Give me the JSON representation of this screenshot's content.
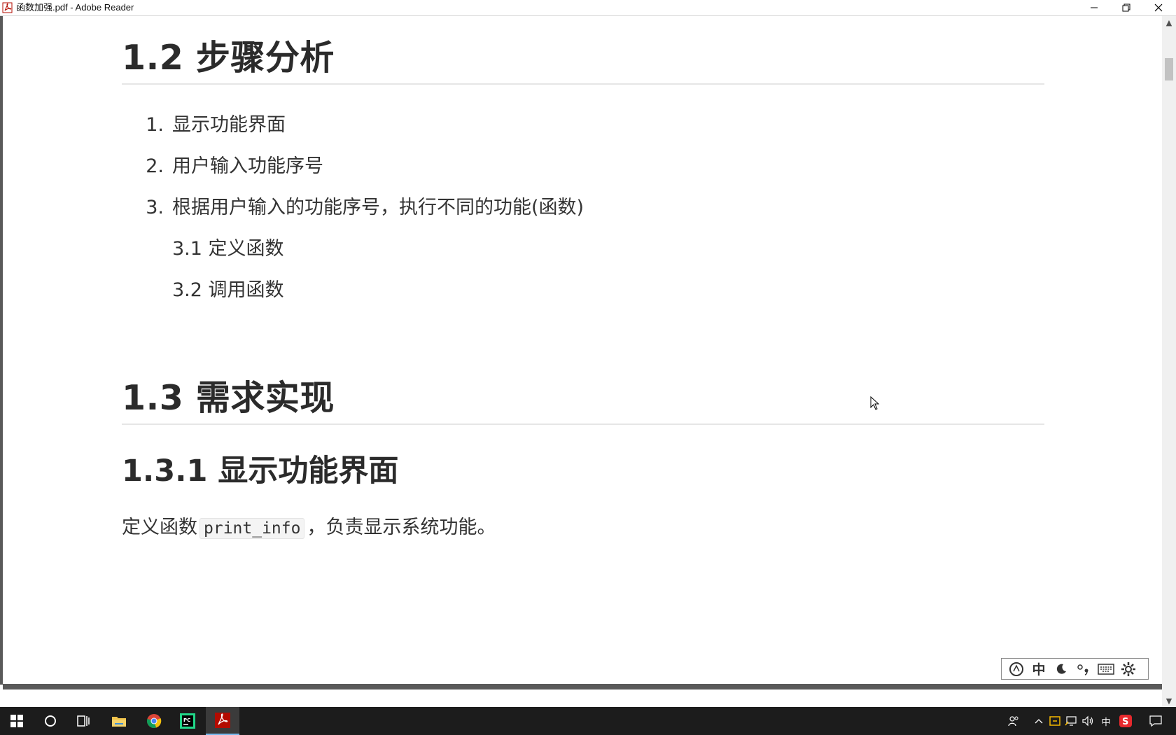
{
  "window": {
    "title": "函数加强.pdf - Adobe Reader"
  },
  "document": {
    "section_1_2": {
      "heading": "1.2 步骤分析",
      "steps": [
        {
          "num": "1.",
          "text": "显示功能界面"
        },
        {
          "num": "2.",
          "text": "用户输入功能序号"
        },
        {
          "num": "3.",
          "text": "根据用户输入的功能序号，执行不同的功能(函数)"
        }
      ],
      "substeps": [
        "3.1 定义函数",
        "3.2 调用函数"
      ]
    },
    "section_1_3": {
      "heading": "1.3 需求实现"
    },
    "section_1_3_1": {
      "heading": "1.3.1 显示功能界面",
      "para_before": "定义函数",
      "code": "print_info",
      "para_after": "，负责显示系统功能。"
    }
  },
  "ime_toolbar": {
    "items": [
      "logo-icon",
      "中",
      "moon-icon",
      "punctuation-icon",
      "keyboard-icon",
      "gear-icon"
    ],
    "mode_label": "中"
  },
  "taskbar": {
    "apps": [
      "start-icon",
      "cortana-icon",
      "task-view-icon",
      "file-explorer-icon",
      "chrome-icon",
      "pycharm-icon",
      "acrobat-icon"
    ],
    "tray": {
      "ime_label": "中"
    }
  }
}
